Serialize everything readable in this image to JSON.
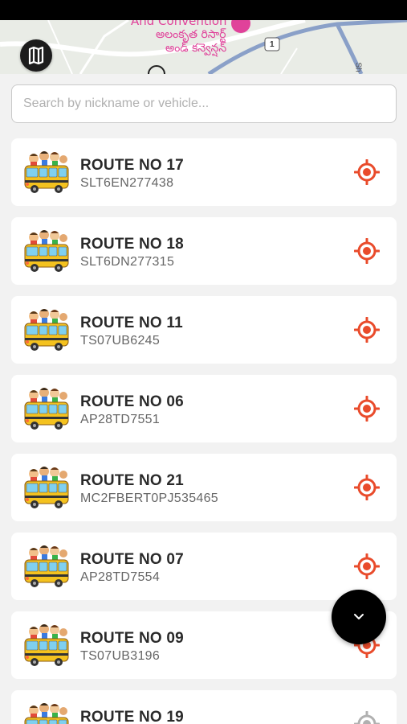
{
  "map": {
    "labels": [
      "And Convention",
      "అలంకృత రిసార్ట్",
      "అండ్ కన్వెన్షన్"
    ],
    "road_shield": "1",
    "edge_label": "Sh"
  },
  "search": {
    "placeholder": "Search by nickname or vehicle..."
  },
  "colors": {
    "accent": "#e94b2b",
    "text": "#2a2a2a",
    "subtext": "#666666",
    "map_label": "#e0429a"
  },
  "routes": [
    {
      "name": "ROUTE NO 17",
      "vehicle": "SLT6EN277438"
    },
    {
      "name": "ROUTE NO 18",
      "vehicle": "SLT6DN277315"
    },
    {
      "name": "ROUTE NO 11",
      "vehicle": "TS07UB6245"
    },
    {
      "name": "ROUTE NO 06",
      "vehicle": "AP28TD7551"
    },
    {
      "name": "ROUTE NO 21",
      "vehicle": "MC2FBERT0PJ535465"
    },
    {
      "name": "ROUTE NO 07",
      "vehicle": "AP28TD7554"
    },
    {
      "name": "ROUTE NO 09",
      "vehicle": "TS07UB3196"
    },
    {
      "name": "ROUTE NO 19",
      "vehicle": ""
    }
  ],
  "icons": {
    "map_toggle": "map-icon",
    "route_thumb": "school-bus-icon",
    "locate": "locate-target-icon",
    "fab": "chevron-down-icon"
  }
}
